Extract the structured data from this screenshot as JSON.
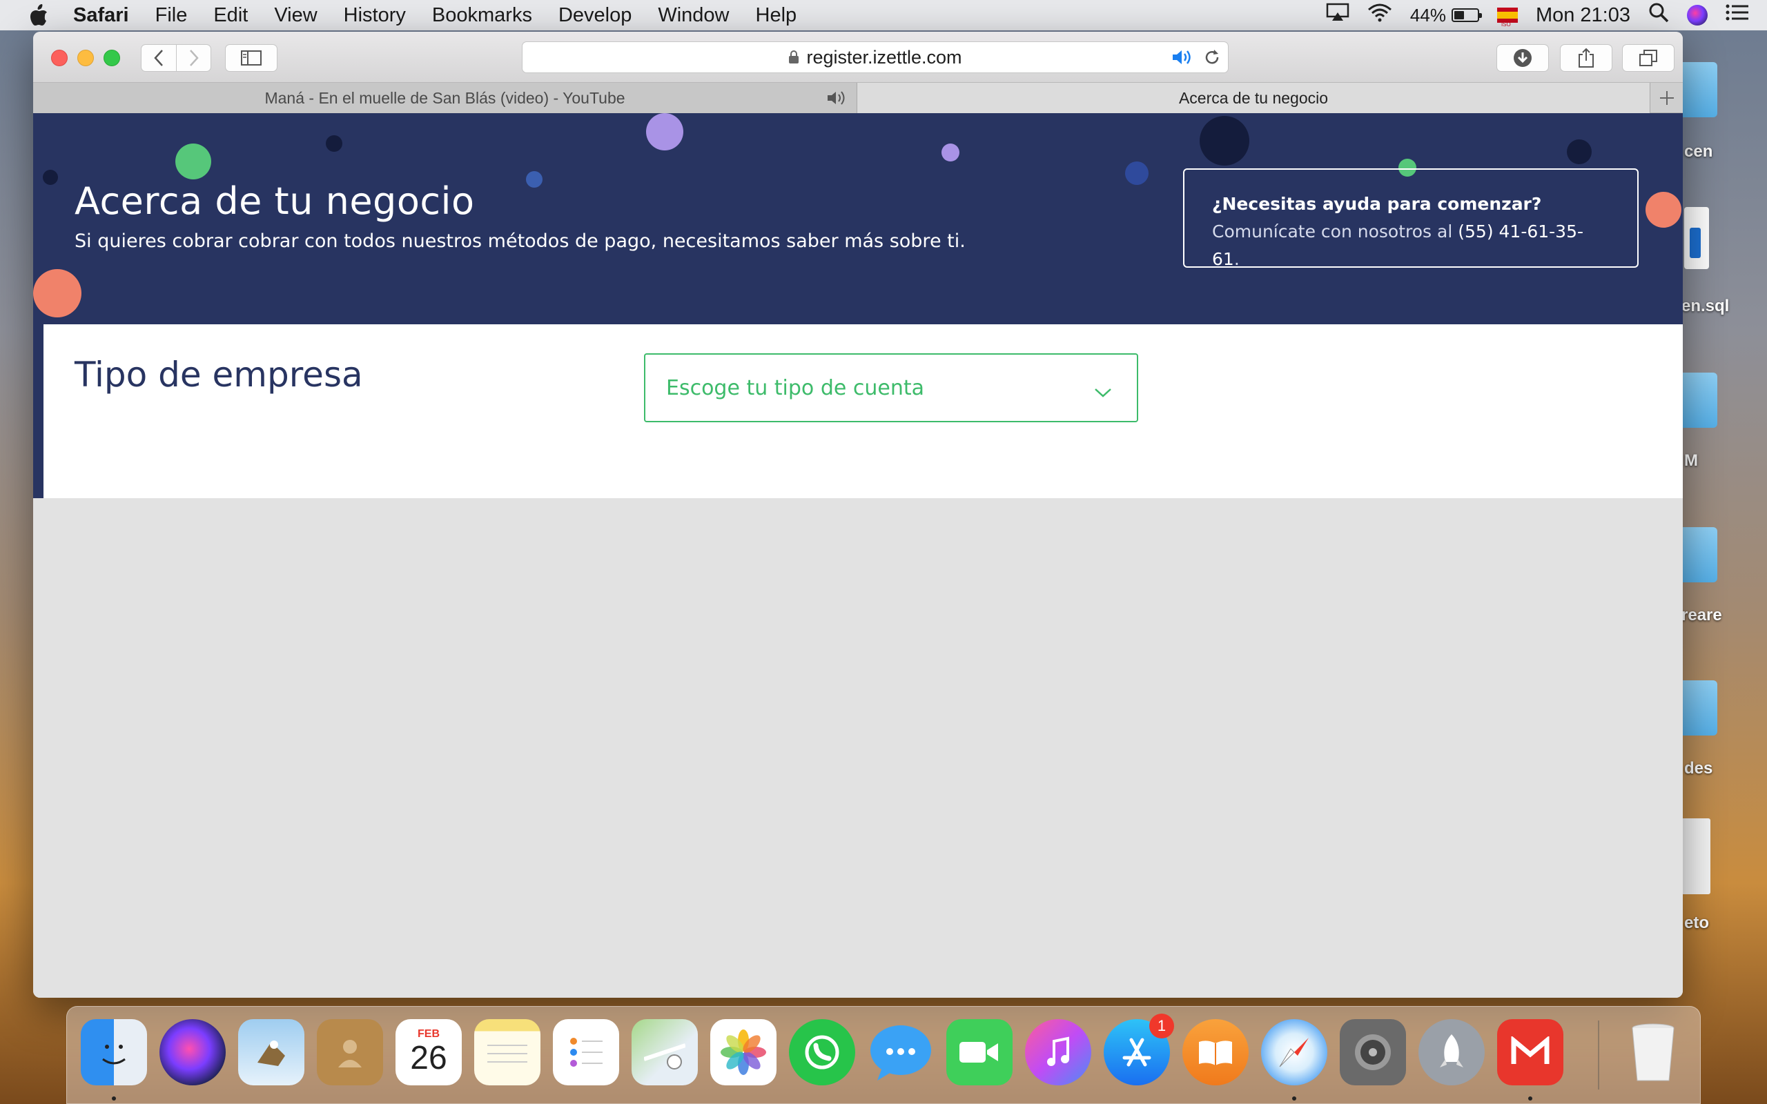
{
  "menubar": {
    "app_name": "Safari",
    "items": [
      "File",
      "Edit",
      "View",
      "History",
      "Bookmarks",
      "Develop",
      "Window",
      "Help"
    ],
    "battery_percent": "44%",
    "battery_level": 0.44,
    "clock": "Mon 21:03",
    "input_source": "ISO"
  },
  "desktop": {
    "labels": [
      "cen",
      "en.sql",
      "M",
      "reare",
      "des",
      "eto"
    ]
  },
  "browser": {
    "url": "register.izettle.com",
    "tabs": [
      {
        "title": "Maná - En el muelle de San Blás (video) - YouTube",
        "playing_audio": true
      },
      {
        "title": "Acerca de tu negocio",
        "active": true
      }
    ]
  },
  "page": {
    "hero": {
      "title": "Acerca de tu negocio",
      "subtitle": "Si quieres cobrar cobrar con todos nuestros métodos de pago, necesitamos saber más sobre ti.",
      "help_bold": "¿Necesitas ayuda para comenzar?",
      "help_text": " Comunícate con nosotros al ",
      "help_phone": "(55) 41-61-35-61",
      "help_end": "."
    },
    "section": {
      "title": "Tipo de empresa",
      "select_placeholder": "Escoge tu tipo de cuenta"
    }
  },
  "dock": {
    "calendar_month": "FEB",
    "calendar_day": "26",
    "app_store_badge": "1",
    "apps": [
      "finder",
      "siri",
      "mail",
      "contacts",
      "calendar",
      "notes",
      "reminders",
      "maps",
      "photos",
      "whatsapp",
      "messages",
      "facetime",
      "itunes",
      "app-store",
      "ibooks",
      "safari",
      "system-preferences",
      "launchpad",
      "gmail",
      "trash"
    ]
  },
  "colors": {
    "hero_bg": "#283461",
    "accent_green": "#3dbb6a",
    "coral": "#f0826a",
    "purple": "#a993e6"
  }
}
